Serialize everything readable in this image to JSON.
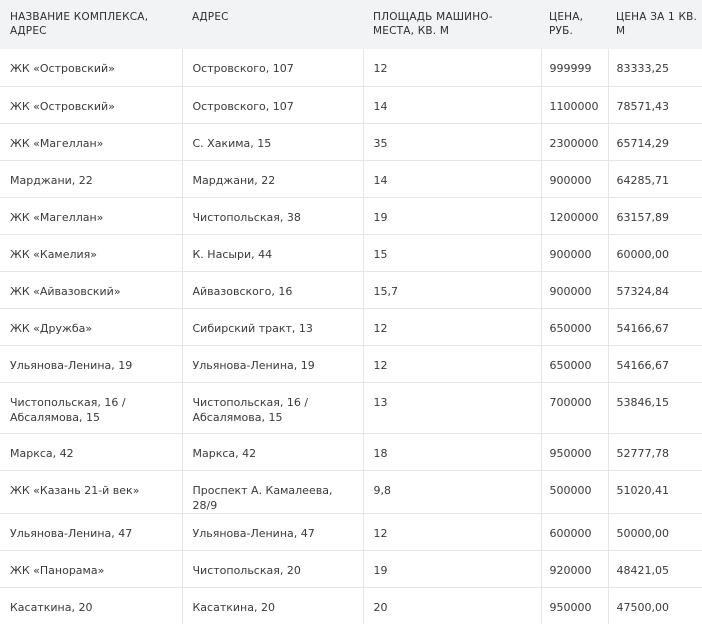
{
  "table": {
    "headers": [
      "НАЗВАНИЕ КОМПЛЕКСА, АДРЕС",
      "АДРЕС",
      "ПЛОЩАДЬ МАШИНО-МЕСТА, КВ. М",
      "ЦЕНА, РУБ.",
      "ЦЕНА ЗА 1 КВ. М"
    ],
    "rows": [
      [
        "ЖК «Островский»",
        "Островского, 107",
        "12",
        "999999",
        "83333,25"
      ],
      [
        "ЖК «Островский»",
        "Островского, 107",
        "14",
        "1100000",
        "78571,43"
      ],
      [
        "ЖК «Магеллан»",
        "С. Хакима, 15",
        "35",
        "2300000",
        "65714,29"
      ],
      [
        "Марджани, 22",
        "Марджани, 22",
        "14",
        "900000",
        "64285,71"
      ],
      [
        "ЖК «Магеллан»",
        "Чистопольская, 38",
        "19",
        "1200000",
        "63157,89"
      ],
      [
        "ЖК «Камелия»",
        "К. Насыри, 44",
        "15",
        "900000",
        "60000,00"
      ],
      [
        "ЖК «Айвазовский»",
        "Айвазовского, 16",
        "15,7",
        "900000",
        "57324,84"
      ],
      [
        "ЖК «Дружба»",
        "Сибирский тракт, 13",
        "12",
        "650000",
        "54166,67"
      ],
      [
        "Ульянова-Ленина, 19",
        "Ульянова-Ленина, 19",
        "12",
        "650000",
        "54166,67"
      ],
      [
        "Чистопольская, 16 / Абсалямова, 15",
        "Чистопольская, 16 / Абсалямова, 15",
        "13",
        "700000",
        "53846,15"
      ],
      [
        "Маркса, 42",
        "Маркса, 42",
        "18",
        "950000",
        "52777,78"
      ],
      [
        "ЖК «Казань 21-й век»",
        "Проспект А. Камалеева, 28/9",
        "9,8",
        "500000",
        "51020,41"
      ],
      [
        "Ульянова-Ленина, 47",
        "Ульянова-Ленина, 47",
        "12",
        "600000",
        "50000,00"
      ],
      [
        "ЖК «Панорама»",
        "Чистопольская, 20",
        "19",
        "920000",
        "48421,05"
      ],
      [
        "Касаткина, 20",
        "Касаткина, 20",
        "20",
        "950000",
        "47500,00"
      ]
    ]
  }
}
